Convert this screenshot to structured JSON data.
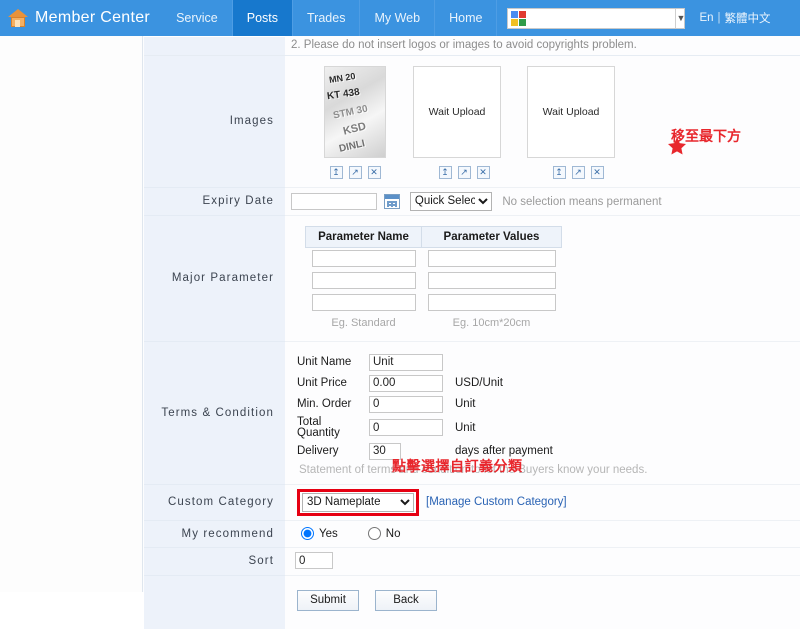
{
  "header": {
    "brand": "Member Center",
    "brand_icon": "house-icon",
    "tabs": [
      {
        "label": "Service",
        "active": false
      },
      {
        "label": "Posts",
        "active": true
      },
      {
        "label": "Trades",
        "active": false
      },
      {
        "label": "My Web",
        "active": false
      },
      {
        "label": "Home",
        "active": false
      }
    ],
    "search": {
      "value": "",
      "placeholder": "",
      "icon": "google-icon",
      "caret_icon": "chevron-down-icon"
    },
    "lang": {
      "en": "En",
      "separator": "|",
      "zh": "繁體中文"
    },
    "colors": {
      "nav_bg": "#3b93e0",
      "nav_active": "#1778cd",
      "accent_red": "#e8272d",
      "link_blue": "#2a63b4"
    }
  },
  "notice": {
    "text": "2. Please do not insert logos or images to avoid copyrights problem."
  },
  "rows": {
    "images_label": "Images",
    "expiry_label": "Expiry Date",
    "major_param_label": "Major Parameter",
    "terms_label": "Terms & Condition",
    "custom_category_label": "Custom Category",
    "my_recommend_label": "My recommend",
    "sort_label": "Sort"
  },
  "images": {
    "slots": [
      {
        "type": "photo",
        "alt": "3D nameplate chrome letters photo",
        "plate_lines": [
          "MN 20",
          "KT 438",
          "STM 30",
          "KSD",
          "DINLI"
        ]
      },
      {
        "type": "empty",
        "placeholder": "Wait Upload"
      },
      {
        "type": "empty",
        "placeholder": "Wait Upload"
      }
    ],
    "actions": [
      {
        "name": "upload-icon",
        "glyph": "↥"
      },
      {
        "name": "expand-icon",
        "glyph": "↗"
      },
      {
        "name": "delete-icon",
        "glyph": "✕"
      }
    ],
    "annotation": {
      "star_icon": "red-star-icon",
      "text": "移至最下方",
      "color": "#e8272d"
    }
  },
  "expiry": {
    "date_value": "",
    "calendar_icon": "calendar-icon",
    "quick_select": "Quick Select",
    "quick_select_options": [
      "Quick Select"
    ],
    "hint": "No selection means permanent"
  },
  "major_parameter": {
    "columns": [
      "Parameter Name",
      "Parameter Values"
    ],
    "rows": [
      {
        "name": "",
        "value": ""
      },
      {
        "name": "",
        "value": ""
      },
      {
        "name": "",
        "value": ""
      }
    ],
    "examples": [
      "Eg. Standard",
      "Eg. 10cm*20cm"
    ]
  },
  "terms": {
    "fields": [
      {
        "label": "Unit Name",
        "value": "Unit",
        "unit": ""
      },
      {
        "label": "Unit Price",
        "value": "0.00",
        "unit": "USD/Unit"
      },
      {
        "label": "Min. Order",
        "value": "0",
        "unit": "Unit"
      },
      {
        "label": "Total Quantity",
        "value": "0",
        "unit": "Unit"
      },
      {
        "label": "Delivery",
        "value": "30",
        "unit": "days after payment"
      }
    ],
    "statement": "Statement of terms and condition to let the Buyers know your needs.",
    "annotation": {
      "text": "點擊選擇自訂義分類",
      "color": "#e8272d"
    }
  },
  "custom_category": {
    "selected": "3D Nameplate",
    "options": [
      "3D Nameplate"
    ],
    "manage_link": "[Manage Custom Category]",
    "highlight_color": "#e60012"
  },
  "my_recommend": {
    "options": [
      {
        "label": "Yes",
        "checked": true
      },
      {
        "label": "No",
        "checked": false
      }
    ]
  },
  "sort": {
    "value": "0"
  },
  "buttons": {
    "submit": "Submit",
    "back": "Back"
  }
}
